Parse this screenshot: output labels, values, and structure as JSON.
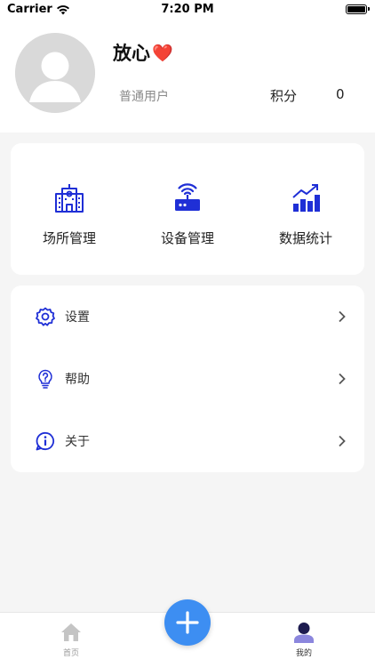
{
  "status_bar": {
    "carrier": "Carrier",
    "time": "7:20 PM"
  },
  "profile": {
    "name": "放心",
    "name_emoji": "❤️",
    "role": "普通用户",
    "points_label": "积分",
    "points_value": "0"
  },
  "features": [
    {
      "label": "场所管理",
      "icon": "building-icon"
    },
    {
      "label": "设备管理",
      "icon": "router-icon"
    },
    {
      "label": "数据统计",
      "icon": "bar-chart-icon"
    }
  ],
  "menu": [
    {
      "label": "设置",
      "icon": "gear-icon"
    },
    {
      "label": "帮助",
      "icon": "lightbulb-icon"
    },
    {
      "label": "关于",
      "icon": "info-icon"
    }
  ],
  "tabs": [
    {
      "label": "首页",
      "icon": "home-icon"
    },
    {
      "label": "我的",
      "icon": "user-icon"
    }
  ],
  "colors": {
    "accent": "#1f2fd6",
    "fab": "#3d8ef2",
    "background": "#f5f5f5"
  }
}
